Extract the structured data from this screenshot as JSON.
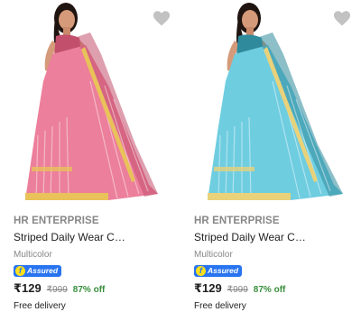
{
  "products": [
    {
      "brand": "HR ENTERPRISE",
      "title": "Striped Daily Wear Cotto...",
      "color": "Multicolor",
      "assured_label": "Assured",
      "assured_glyph": "f",
      "price": "₹129",
      "mrp": "₹999",
      "discount": "87% off",
      "delivery": "Free delivery",
      "saree_color": "#ec7f9b",
      "saree_dark": "#c2506d",
      "border_color": "#e9c25a",
      "wishlist_icon": "heart-icon"
    },
    {
      "brand": "HR ENTERPRISE",
      "title": "Striped Daily Wear Cotto...",
      "color": "Multicolor",
      "assured_label": "Assured",
      "assured_glyph": "f",
      "price": "₹129",
      "mrp": "₹999",
      "discount": "87% off",
      "delivery": "Free delivery",
      "saree_color": "#6fcde0",
      "saree_dark": "#2f8a9c",
      "border_color": "#e9d27a",
      "wishlist_icon": "heart-icon"
    }
  ]
}
